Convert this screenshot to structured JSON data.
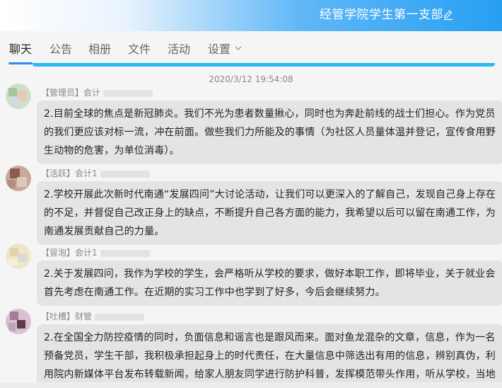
{
  "header": {
    "title": "经管学院学生第一支部"
  },
  "tabs": [
    {
      "label": "聊天",
      "active": true
    },
    {
      "label": "公告"
    },
    {
      "label": "相册"
    },
    {
      "label": "文件"
    },
    {
      "label": "活动"
    },
    {
      "label": "设置"
    }
  ],
  "chat": {
    "timestamp": "2020/3/12 19:54:08",
    "messages": [
      {
        "sender": "【管理员】会计",
        "text": "2.目前全球的焦点是新冠肺炎。我们不光为患者数量揪心，同时也为奔赴前线的战士们担心。作为党员的我们更应该对标一流，冲在前面。做些我们力所能及的事情（为社区人员量体温并登记，宣传食用野生动物的危害，为单位消毒）。"
      },
      {
        "sender": "【活跃】会计1",
        "text": "2.学校开展此次新时代南通“发展四问”大讨论活动，让我们可以更深入的了解自己，发现自己身上存在的不足，并督促自己改正身上的缺点，不断提升自己各方面的能力，我希望以后可以留在南通工作，为南通发展贡献自己的力量。"
      },
      {
        "sender": "【冒泡】会计1",
        "text": "2.关于发展四问，我作为学校的学生，会严格听从学校的要求，做好本职工作，即将毕业，关于就业会首先考虑在南通工作。在近期的实习工作中也学到了好多，今后会继续努力。"
      },
      {
        "sender": "【吐槽】财管",
        "text": "2.在全国全力防控疫情的同时，负面信息和谣言也是跟风而来。面对鱼龙混杂的文章，信息，作为一名预备党员，学生干部，我积极承担起身上的时代责任，在大量信息中筛选出有用的信息，辨别真伪，利用院内新媒体平台发布转载新闻，给家人朋友同学进行防护科普，发挥模范带头作用，听从学校，当地"
      }
    ]
  }
}
